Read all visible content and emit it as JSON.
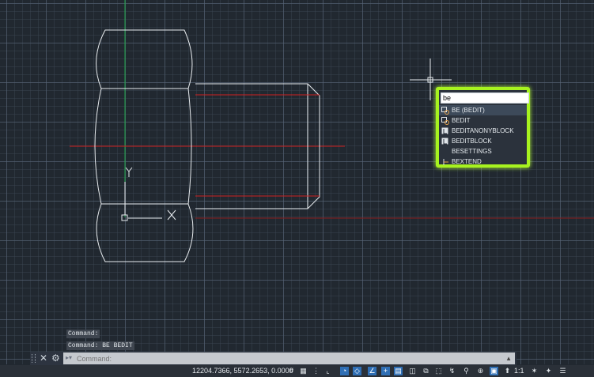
{
  "autocomplete": {
    "input_value": "be",
    "items": [
      {
        "label": "BE (BEDIT)",
        "icon": "block-editor-icon"
      },
      {
        "label": "BEDIT",
        "icon": "block-editor-icon"
      },
      {
        "label": "BEDITANONYBLOCK",
        "icon": "block-icon"
      },
      {
        "label": "BEDITBLOCK",
        "icon": "block-icon"
      },
      {
        "label": "BESETTINGS",
        "icon": ""
      },
      {
        "label": "BEXTEND",
        "icon": "extend-icon"
      }
    ]
  },
  "history": [
    "Command:",
    "Command: BE BEDIT"
  ],
  "command_line": {
    "placeholder": "Command:"
  },
  "status": {
    "coordinates": "12204.7366, 5572.2653, 0.0000",
    "scale": "1:1"
  },
  "colors": {
    "highlight": "#a7f31f",
    "grid_bg": "#212830",
    "accent": "#2f6fb5",
    "red_line": "#e02020",
    "green_axis": "#1fa84a"
  }
}
